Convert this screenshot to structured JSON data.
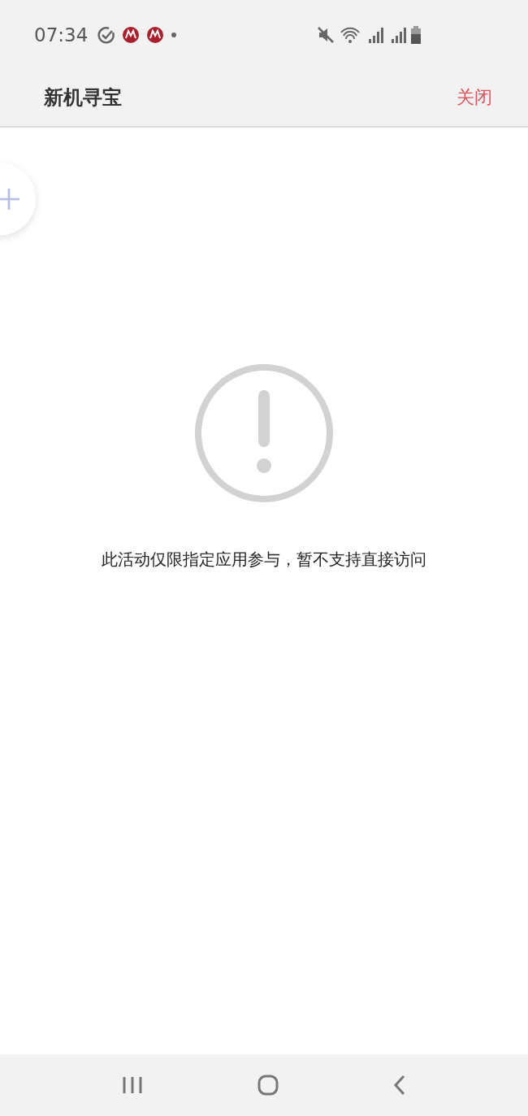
{
  "status_bar": {
    "time": "07:34"
  },
  "app_bar": {
    "title": "新机寻宝",
    "close_button": "关闭"
  },
  "message": "此活动仅限指定应用参与，暂不支持直接访问"
}
